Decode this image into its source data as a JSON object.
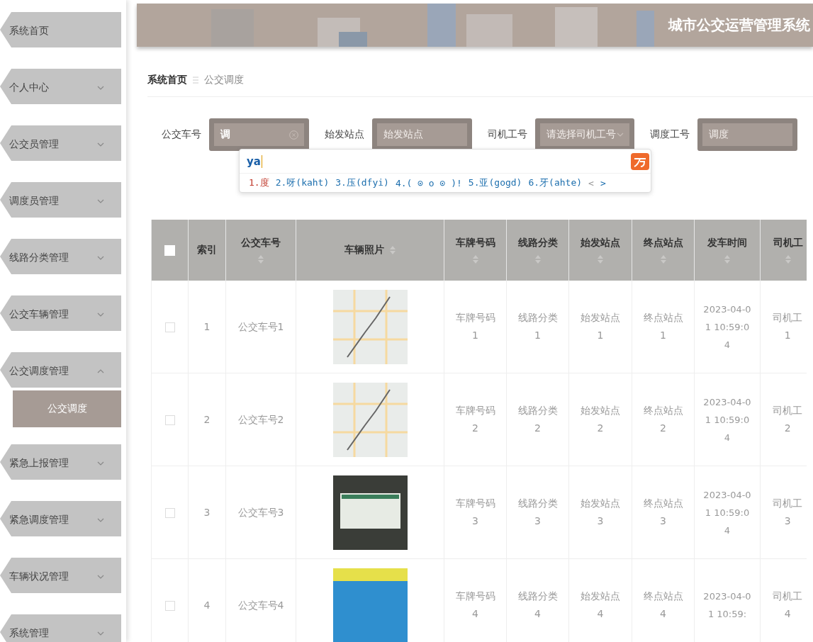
{
  "sidebar": {
    "items": [
      {
        "label": "系统首页",
        "kind": "link",
        "expanded": false
      },
      {
        "label": "个人中心",
        "kind": "menu",
        "expanded": false
      },
      {
        "label": "公交员管理",
        "kind": "menu",
        "expanded": false
      },
      {
        "label": "调度员管理",
        "kind": "menu",
        "expanded": false
      },
      {
        "label": "线路分类管理",
        "kind": "menu",
        "expanded": false
      },
      {
        "label": "公交车辆管理",
        "kind": "menu",
        "expanded": false
      },
      {
        "label": "公交调度管理",
        "kind": "menu",
        "expanded": true,
        "children": [
          {
            "label": "公交调度",
            "selected": true
          }
        ]
      },
      {
        "label": "紧急上报管理",
        "kind": "menu",
        "expanded": false
      },
      {
        "label": "紧急调度管理",
        "kind": "menu",
        "expanded": false
      },
      {
        "label": "车辆状况管理",
        "kind": "menu",
        "expanded": false
      },
      {
        "label": "系统管理",
        "kind": "menu",
        "expanded": false
      }
    ]
  },
  "header": {
    "title": "城市公交运营管理系统"
  },
  "breadcrumb": [
    "系统首页",
    "公交调度"
  ],
  "search": [
    {
      "label": "公交车号",
      "kind": "text",
      "value": "调"
    },
    {
      "label": "始发站点",
      "kind": "text",
      "placeholder": "始发站点"
    },
    {
      "label": "司机工号",
      "kind": "select",
      "placeholder": "请选择司机工号"
    },
    {
      "label": "调度工号",
      "kind": "text",
      "placeholder": "调度"
    }
  ],
  "ime": {
    "input": "ya",
    "candidates": [
      "1.度",
      "2.呀(kaht)",
      "3.压(dfyi)",
      "4.( ⊙ o ⊙ )!",
      "5.亚(gogd)",
      "6.牙(ahte)"
    ],
    "prev": "<",
    "next": ">"
  },
  "table": {
    "header_checked": false,
    "columns": [
      {
        "label": "索引",
        "sortable": false
      },
      {
        "label": "公交车号",
        "sortable": true
      },
      {
        "label": "车辆照片",
        "sortable": true
      },
      {
        "label": "车牌号码",
        "sortable": true
      },
      {
        "label": "线路分类",
        "sortable": true
      },
      {
        "label": "始发站点",
        "sortable": true
      },
      {
        "label": "终点站点",
        "sortable": true
      },
      {
        "label": "发车时间",
        "sortable": true
      },
      {
        "label": "司机工",
        "sortable": true
      }
    ],
    "rows": [
      {
        "checked": false,
        "index": "1",
        "bus_no": "公交车号1",
        "plate": "车牌号码1",
        "route": "线路分类1",
        "start": "始发站点1",
        "end": "终点站点1",
        "time": "2023-04-01 10:59:04",
        "driver": "司机工\n1"
      },
      {
        "checked": false,
        "index": "2",
        "bus_no": "公交车号2",
        "plate": "车牌号码2",
        "route": "线路分类2",
        "start": "始发站点2",
        "end": "终点站点2",
        "time": "2023-04-01 10:59:04",
        "driver": "司机工\n2"
      },
      {
        "checked": false,
        "index": "3",
        "bus_no": "公交车号3",
        "plate": "车牌号码3",
        "route": "线路分类3",
        "start": "始发站点3",
        "end": "终点站点3",
        "time": "2023-04-01 10:59:04",
        "driver": "司机工\n3"
      },
      {
        "checked": false,
        "index": "4",
        "bus_no": "公交车号4",
        "plate": "车牌号码4",
        "route": "线路分类4",
        "start": "始发站点4",
        "end": "终点站点4",
        "time": "2023-04-01 10:59:",
        "driver": "司机工\n4"
      }
    ]
  }
}
